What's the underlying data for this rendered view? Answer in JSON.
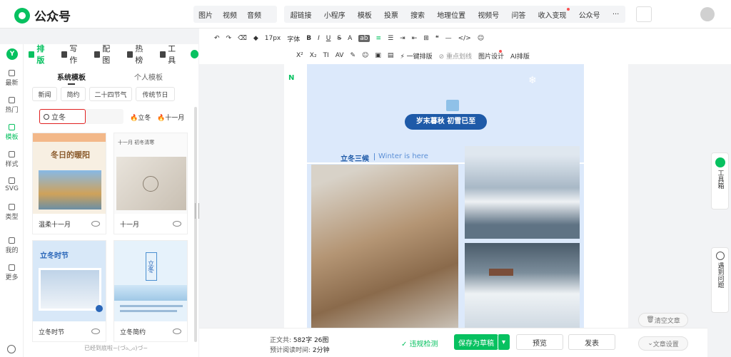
{
  "app": {
    "title": "公众号"
  },
  "insert_menu": {
    "group1": [
      "图片",
      "视频",
      "音频"
    ],
    "group2": [
      "超链接",
      "小程序",
      "模板",
      "投票",
      "搜索",
      "地理位置",
      "视频号",
      "问答",
      "收入变现",
      "公众号",
      "···"
    ]
  },
  "toolbar": {
    "row1": [
      "↶",
      "↷",
      "⌫",
      "◆",
      "17px",
      "字体",
      "B",
      "I",
      "U",
      "S",
      "A",
      "ab",
      "≡",
      "☰",
      "⇥",
      "⇤",
      "⊞",
      "❝",
      "—",
      "</>",
      "☺"
    ],
    "row2": [
      "X²",
      "X₂",
      "TI",
      "AV",
      "✎",
      "☺",
      "▣",
      "▤",
      "⚡ 一键排版",
      "⊘ 重点划线",
      "图片设计",
      "AI排版"
    ]
  },
  "left_rail": {
    "items": [
      "最新",
      "热门",
      "模板",
      "样式",
      "SVG",
      "类型",
      "我的",
      "更多"
    ]
  },
  "nav_tabs": [
    "排版",
    "写作",
    "配图",
    "热榜",
    "工具"
  ],
  "template_panel": {
    "tabs": [
      "系统模板",
      "个人模板"
    ],
    "chips": [
      "新闻",
      "简约",
      "二十四节气",
      "传统节日"
    ],
    "search_value": "立冬",
    "hot_tags": [
      "立冬",
      "十一月"
    ],
    "cards": [
      {
        "image_text": "冬日的暖阳",
        "label": "温柔十一月"
      },
      {
        "image_text": "十一月 初冬清寒",
        "label": "十一月"
      },
      {
        "image_text": "立冬时节",
        "label": "立冬时节"
      },
      {
        "image_text": "立冬",
        "label": "立冬简约"
      }
    ],
    "loaded_text": "已经到底啦~(づ₀◡₀)づ~"
  },
  "article": {
    "banner": "岁末暮秋 初雪已至",
    "section_title": "立冬三候",
    "section_sub": "Winter is here"
  },
  "bottom": {
    "word_count_label": "正文共:",
    "word_count": "582字 26图",
    "read_time_label": "预计阅读时间:",
    "read_time": "2分钟",
    "check": "违规检测",
    "save": "保存为草稿",
    "preview": "预览",
    "publish": "发表"
  },
  "right_float": {
    "toolbox": "工具箱",
    "help": "遇到问题",
    "clear": "清空文章",
    "settings": "文章设置"
  },
  "colors": {
    "brand": "#07c160",
    "banner": "#1e5aa8",
    "highlight": "#e02020"
  }
}
